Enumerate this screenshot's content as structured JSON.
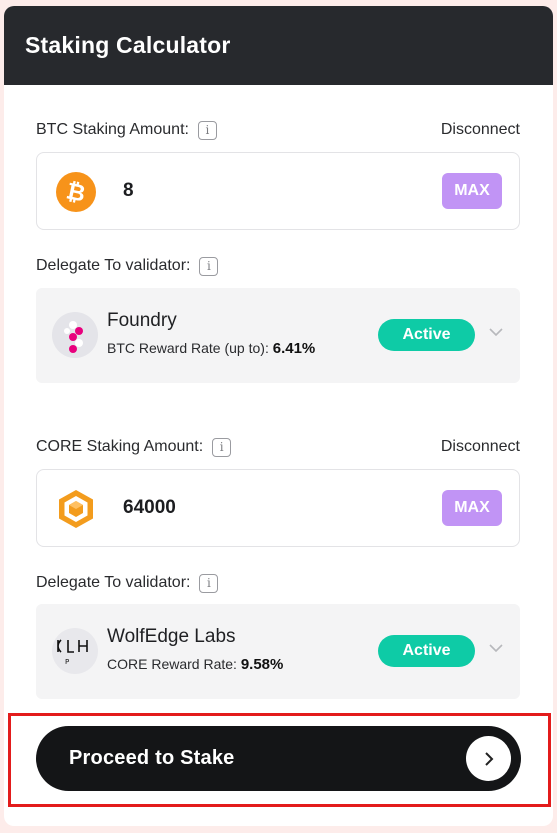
{
  "header": {
    "title": "Staking Calculator"
  },
  "btc_section": {
    "label": "BTC Staking Amount:",
    "disconnect_label": "Disconnect",
    "amount": "8",
    "max_label": "MAX",
    "asset_icon": "bitcoin-icon"
  },
  "btc_delegate": {
    "label": "Delegate To validator:",
    "validator_name": "Foundry",
    "rate_label": "BTC Reward Rate (up to):",
    "rate_value": "6.41%",
    "status": "Active"
  },
  "core_section": {
    "label": "CORE Staking Amount:",
    "disconnect_label": "Disconnect",
    "amount": "64000",
    "max_label": "MAX",
    "asset_icon": "core-hexagon-icon"
  },
  "core_delegate": {
    "label": "Delegate To validator:",
    "validator_name": "WolfEdge Labs",
    "rate_label": "CORE Reward Rate:",
    "rate_value": "9.58%",
    "status": "Active"
  },
  "proceed": {
    "label": "Proceed to Stake"
  },
  "colors": {
    "header_bg": "#27292d",
    "max_button": "#c194f5",
    "active_pill": "#0ecba6",
    "bitcoin_orange": "#f7931a",
    "core_orange": "#f39c1d",
    "proceed_bg": "#141517",
    "highlight": "#e31b1b"
  }
}
